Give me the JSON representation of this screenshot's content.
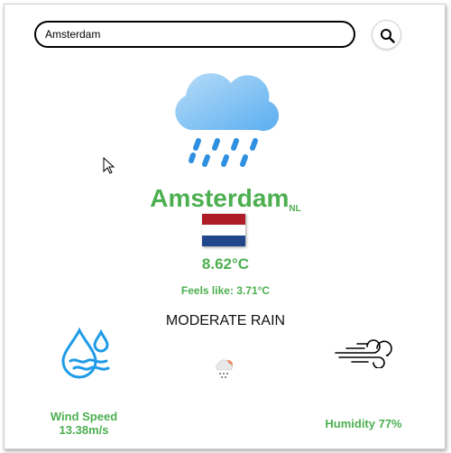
{
  "search": {
    "value": "Amsterdam",
    "button_icon": "search-icon"
  },
  "weather": {
    "icon": "cloud-rain-icon",
    "city": "Amsterdam",
    "country": "NL",
    "flag_icon": "netherlands-flag-icon",
    "temperature": "8.62°C",
    "feels_like": "Feels like: 3.71°C",
    "description": "moderate rain",
    "description_icon": "small-rain-cloud-icon"
  },
  "details": {
    "wind_label": "Wind Speed",
    "wind_value": "13.38m/s",
    "humidity": "Humidity 77%",
    "left_icon": "water-drop-icon",
    "right_icon": "wind-icon"
  },
  "colors": {
    "accent": "#4caf50",
    "cloud": "#7dbff5",
    "rain": "#2f8fe0",
    "flag_red": "#ae1c28",
    "flag_blue": "#21468b"
  }
}
